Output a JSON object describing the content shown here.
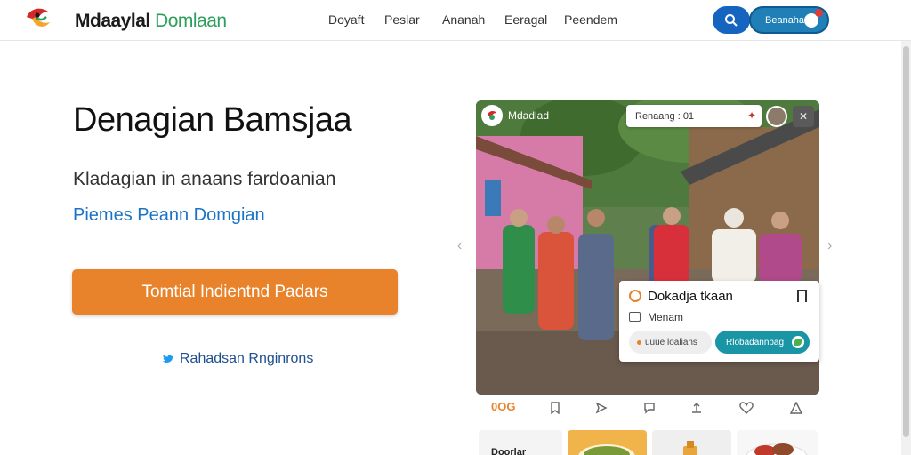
{
  "header": {
    "brand_part1": "Mdaaylal",
    "brand_part2": "Domlaan",
    "nav": [
      "Doyaft",
      "Peslar",
      "Ananah",
      "Eeragal",
      "Peendem"
    ],
    "pill_label": "Beanahaa",
    "accent_blue": "#1565c0",
    "pill_color": "#1f7fb6"
  },
  "hero": {
    "title": "Denagian Bamsjaa",
    "subtitle": "Kladagian in anaans fardoanian",
    "link": "Piemes Peann Domgian",
    "cta_label": "Tomtial Indientnd Padars",
    "cta_color": "#e8832b",
    "twitter_label": "Rahadsan Rnginrons"
  },
  "photo_card": {
    "brand_label": "Mdadlad",
    "search_text": "Renaang : 01",
    "info_title": "Dokadja tkaan",
    "info_subtitle": "Menam",
    "tag_left": "uuue loalians",
    "tag_right": "Rlobadannbag"
  },
  "actions": {
    "label": "0OG",
    "icons": [
      "bookmark-icon",
      "share-icon",
      "comment-icon",
      "upload-icon",
      "heart-icon",
      "alert-icon"
    ]
  },
  "thumbnails": {
    "first_label": "Doorlar"
  }
}
